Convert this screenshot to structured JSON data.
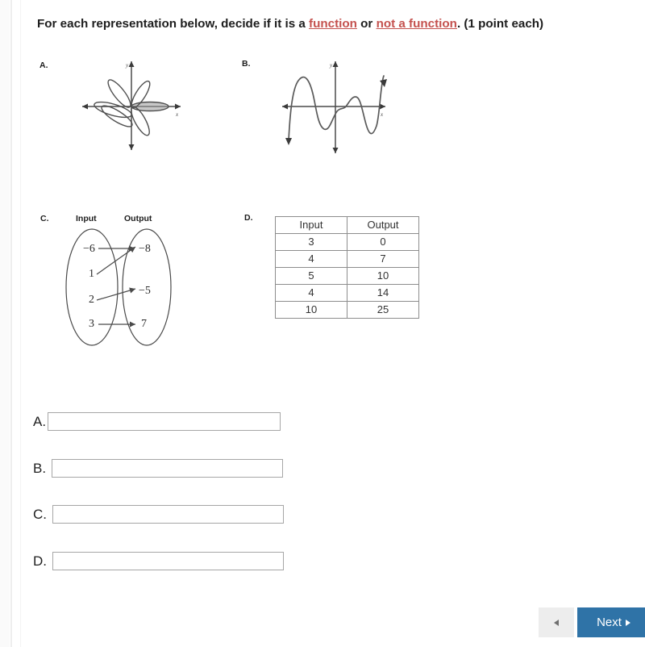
{
  "prompt": {
    "lead": "For each representation below, decide if it is a ",
    "link_function": "function",
    "conjunction": " or ",
    "link_not_function": "not a function",
    "tail": ". (1 point each)"
  },
  "items": {
    "a_letter": "A.",
    "b_letter": "B.",
    "c_letter": "C.",
    "d_letter": "D."
  },
  "graph_a": {
    "type": "polar-rose",
    "x_axis_label": "x",
    "y_axis_label": "y",
    "petal_count": 6,
    "description": "rose curve with six petals centered at origin"
  },
  "graph_b": {
    "type": "wavy-polynomial",
    "x_axis_label": "x",
    "y_axis_label": "y",
    "description": "oscillating curve crossing x-axis several times, arrows down at both ends"
  },
  "mapping_c": {
    "input_header": "Input",
    "output_header": "Output",
    "inputs": [
      "−6",
      "1",
      "2",
      "3"
    ],
    "outputs": [
      "−8",
      "−5",
      "7"
    ],
    "arrows": [
      {
        "from": "−6",
        "to": "−8"
      },
      {
        "from": "1",
        "to": "−8"
      },
      {
        "from": "2",
        "to": "−5"
      },
      {
        "from": "3",
        "to": "7"
      }
    ]
  },
  "table_d": {
    "headers": [
      "Input",
      "Output"
    ],
    "rows": [
      [
        "3",
        "0"
      ],
      [
        "4",
        "7"
      ],
      [
        "5",
        "10"
      ],
      [
        "4",
        "14"
      ],
      [
        "10",
        "25"
      ]
    ]
  },
  "answers": [
    {
      "letter": "A.",
      "value": "",
      "placeholder": ""
    },
    {
      "letter": "B.",
      "value": "",
      "placeholder": ""
    },
    {
      "letter": "C.",
      "value": "",
      "placeholder": ""
    },
    {
      "letter": "D.",
      "value": "",
      "placeholder": ""
    }
  ],
  "footer": {
    "back_label": "",
    "next_label": "Next"
  },
  "colors": {
    "link_red": "#c4514e",
    "next_blue": "#2f73a7",
    "back_gray": "#ededed",
    "table_border": "#8d8d8d",
    "input_border": "#a6a6a6"
  }
}
